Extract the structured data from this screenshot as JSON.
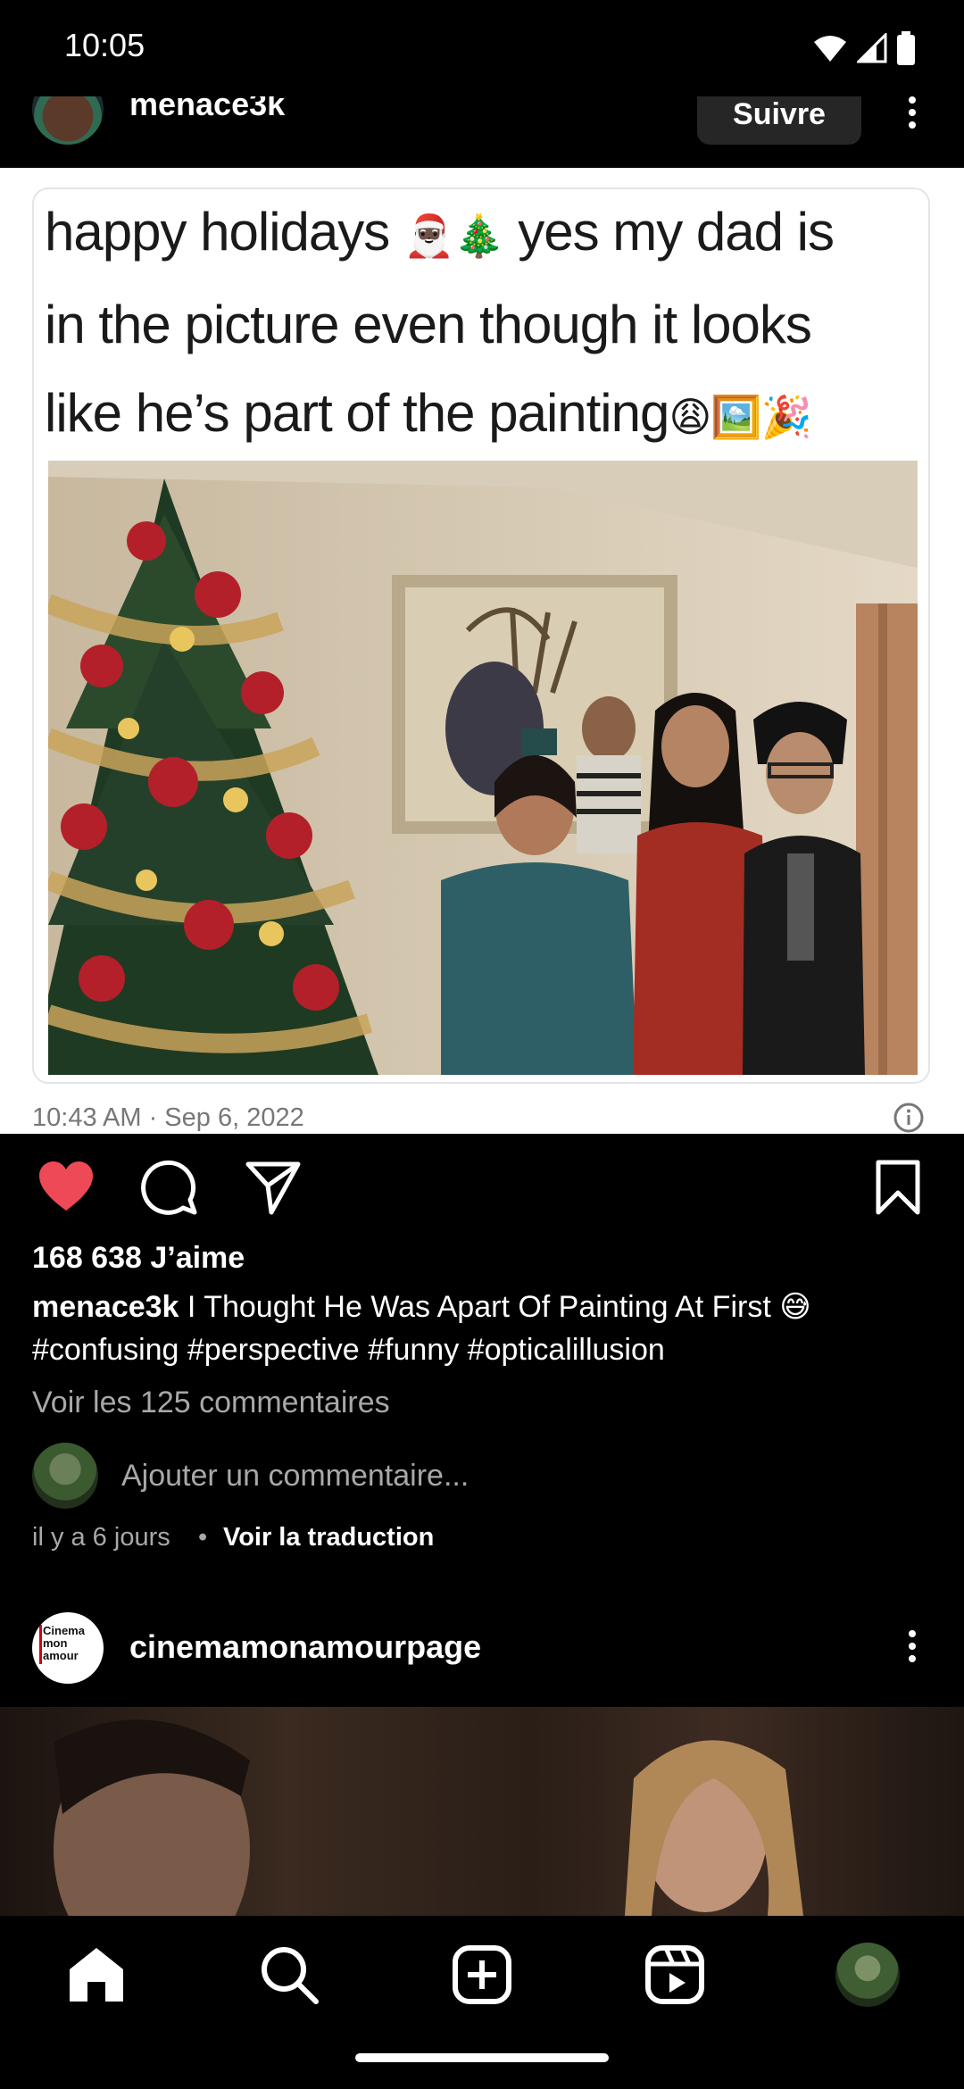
{
  "status_bar": {
    "time": "10:05"
  },
  "post1": {
    "username": "menace3k",
    "follow_label": "Suivre",
    "tweet": {
      "line1_text": "happy holidays",
      "line1_emoji": "🎅🏿🎄",
      "line1_rest": "yes my dad is",
      "line2": "in the picture even though it looks",
      "line3_text": "like he’s part of the painting",
      "line3_emoji": "😩🖼️🎉",
      "timestamp": "10:43 AM · Sep 6, 2022"
    },
    "likes": "168 638 J’aime",
    "caption_user": "menace3k",
    "caption_text": "I Thought He Was Apart Of Painting At First 😅",
    "caption_tags": "#confusing #perspective #funny #opticalillusion",
    "view_comments": "Voir les 125 commentaires",
    "comment_placeholder": "Ajouter un commentaire...",
    "time_ago": "il y a 6 jours",
    "separator": "•",
    "translate": "Voir la traduction"
  },
  "post2": {
    "username": "cinemamonamourpage",
    "avatar_text": "Cinema mon amour"
  },
  "colors": {
    "like": "#ed4956",
    "background": "#000000",
    "secondary_text": "#a8a8a8"
  },
  "icons": [
    "heart-icon",
    "comment-icon",
    "share-icon",
    "bookmark-icon",
    "home-icon",
    "search-icon",
    "create-icon",
    "reels-icon"
  ]
}
